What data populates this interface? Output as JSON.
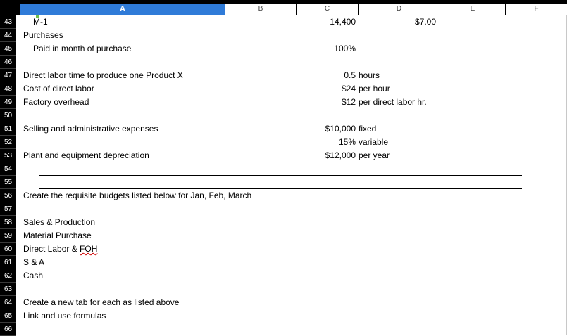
{
  "columns": [
    "A",
    "B",
    "C",
    "D",
    "E",
    "F"
  ],
  "selected_column": "A",
  "rows": [
    "43",
    "44",
    "45",
    "46",
    "47",
    "48",
    "49",
    "50",
    "51",
    "52",
    "53",
    "54",
    "55",
    "56",
    "57",
    "58",
    "59",
    "60",
    "61",
    "62",
    "63",
    "64",
    "65",
    "66"
  ],
  "cells": {
    "r43": {
      "a": "M-1",
      "c": "14,400",
      "d": "$7.00"
    },
    "r44": {
      "a": "Purchases"
    },
    "r45": {
      "a": "Paid in month of purchase",
      "c": "100%"
    },
    "r47": {
      "a": "Direct labor time to produce one Product  X",
      "c": "0.5",
      "d": "hours"
    },
    "r48": {
      "a": "Cost of direct labor",
      "c": "$24",
      "d": "per hour"
    },
    "r49": {
      "a": "Factory overhead",
      "c": "$12",
      "d": "per direct labor hr."
    },
    "r51": {
      "a": "Selling and administrative expenses",
      "c": "$10,000",
      "d": "fixed"
    },
    "r52": {
      "c": "15%",
      "d": "variable"
    },
    "r53": {
      "a": "Plant and equipment depreciation",
      "c": "$12,000",
      "d": "per year"
    },
    "r56": {
      "a": "Create the requisite budgets listed below for Jan, Feb, March"
    },
    "r58": {
      "a": "Sales & Production"
    },
    "r59": {
      "a": "Material Purchase"
    },
    "r60": {
      "a_pre": "Direct Labor & ",
      "a_err": "FOH"
    },
    "r61": {
      "a": "S & A"
    },
    "r62": {
      "a": "Cash"
    },
    "r64": {
      "a": "Create a new tab for each as listed above"
    },
    "r65": {
      "a": "Link and use formulas"
    }
  },
  "colors": {
    "header_bg": "#000000",
    "selected_header": "#2f7bd8",
    "cell_selection": "#6fbe4a"
  }
}
